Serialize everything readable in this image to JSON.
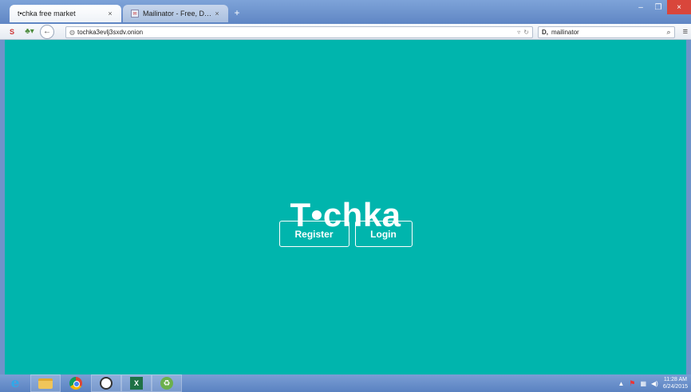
{
  "browser": {
    "tabs": [
      {
        "label": "t•chka free market",
        "active": true
      },
      {
        "label": "Mailinator - Free, Disposab...",
        "active": false
      }
    ],
    "new_tab_label": "+",
    "close_tab_glyph": "×",
    "window_controls": {
      "minimize": "–",
      "restore": "❐",
      "close": "×"
    },
    "url": "tochka3evlj3sxdv.onion",
    "search_engine": "D,",
    "search_text": "mailinator"
  },
  "page": {
    "logo_text": "T•chka",
    "register_label": "Register",
    "login_label": "Login",
    "background_color": "#00b5ad"
  },
  "taskbar": {
    "apps": [
      "ie-icon",
      "folder-icon",
      "chrome-icon",
      "clock-app-icon",
      "excel-icon",
      "recycle-icon"
    ],
    "time": "11:28 AM",
    "date": "6/24/2015"
  }
}
